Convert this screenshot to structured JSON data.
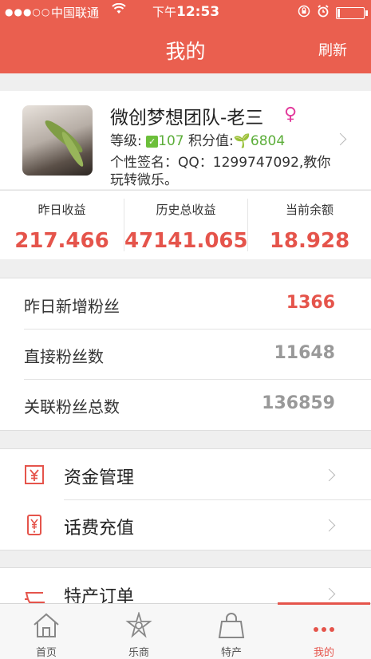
{
  "status_bar": {
    "carrier": "中国联通",
    "time_prefix": "下午",
    "time": "12:53"
  },
  "header": {
    "title": "我的",
    "refresh": "刷新"
  },
  "profile": {
    "name": "微创梦想团队-老三",
    "level_label": "等级:",
    "level_value": "107",
    "points_label": "积分值:",
    "points_value": "6804",
    "signature": "个性签名：QQ：1299747092,教你玩转微乐。"
  },
  "earnings": [
    {
      "label": "昨日收益",
      "value": "217.466"
    },
    {
      "label": "历史总收益",
      "value": "47141.065"
    },
    {
      "label": "当前余额",
      "value": "18.928"
    }
  ],
  "fans": [
    {
      "label": "昨日新增粉丝",
      "value": "1366"
    },
    {
      "label": "直接粉丝数",
      "value": "11648"
    },
    {
      "label": "关联粉丝总数",
      "value": "136859"
    }
  ],
  "menu": [
    {
      "label": "资金管理",
      "icon": "yuan-box-icon"
    },
    {
      "label": "话费充值",
      "icon": "phone-yuan-icon"
    },
    {
      "label": "特产订单",
      "icon": "cart-icon"
    }
  ],
  "tabs": [
    {
      "label": "首页",
      "icon": "home-icon"
    },
    {
      "label": "乐商",
      "icon": "flower-icon"
    },
    {
      "label": "特产",
      "icon": "bag-icon"
    },
    {
      "label": "我的",
      "icon": "more-dots-icon"
    }
  ],
  "colors": {
    "brand": "#ea5f4f",
    "accent_red": "#e5544b",
    "green": "#5cae3a"
  }
}
